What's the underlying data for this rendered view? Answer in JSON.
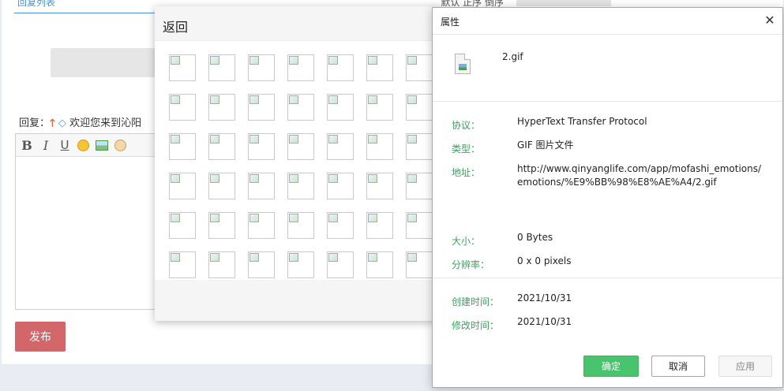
{
  "background": {
    "tab_label": "回复列表",
    "toolbar_right": "默认  正序  倒序",
    "reply_prefix": "回复：",
    "reply_text": "欢迎您来到沁阳",
    "publish_label": "发布"
  },
  "picker": {
    "back_label": "返回",
    "rows": 6,
    "cols": 7
  },
  "properties": {
    "title": "属性",
    "close_glyph": "✕",
    "file_name": "2.gif",
    "protocol_label": "协议：",
    "protocol_value": "HyperText Transfer Protocol",
    "type_label": "类型：",
    "type_value": "GIF 图片文件",
    "address_label": "地址：",
    "address_value": "http://www.qinyanglife.com/app/mofashi_emotions/emotions/%E9%BB%98%E8%AE%A4/2.gif",
    "size_label": "大小：",
    "size_value": "0 Bytes",
    "resolution_label": "分辨率：",
    "resolution_value": "0 x 0 pixels",
    "created_label": "创建时间：",
    "created_value": "2021/10/31",
    "modified_label": "修改时间：",
    "modified_value": "2021/10/31",
    "ok_label": "确定",
    "cancel_label": "取消",
    "apply_label": "应用"
  },
  "colors": {
    "accent_green": "#48c46c",
    "label_green": "#3aa35c",
    "publish_red": "#d26668"
  }
}
